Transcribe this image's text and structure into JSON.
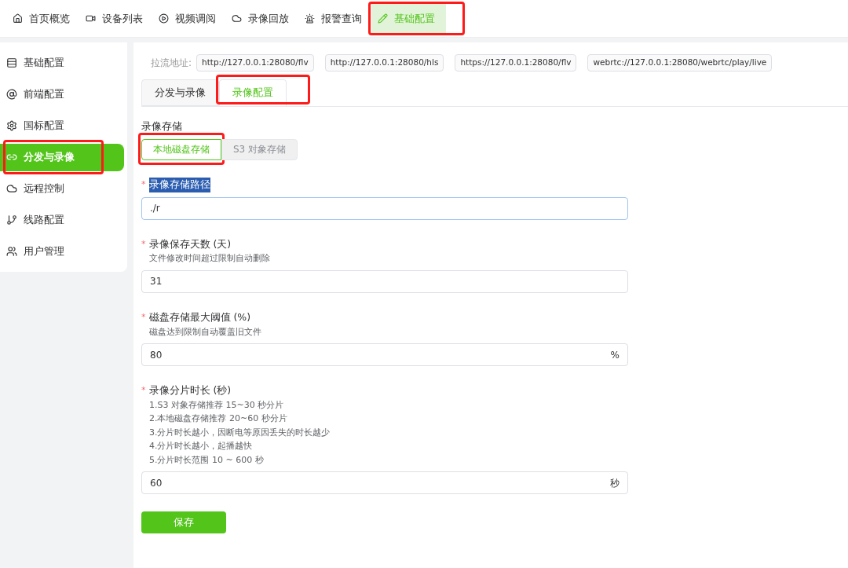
{
  "top_nav": [
    {
      "label": "首页概览",
      "selected": false,
      "highlighted": false
    },
    {
      "label": "设备列表",
      "selected": false,
      "highlighted": false
    },
    {
      "label": "视频调阅",
      "selected": false,
      "highlighted": false
    },
    {
      "label": "录像回放",
      "selected": false,
      "highlighted": false
    },
    {
      "label": "报警查询",
      "selected": false,
      "highlighted": false
    },
    {
      "label": "基础配置",
      "selected": true,
      "highlighted": true
    }
  ],
  "sidebar": {
    "items": [
      {
        "label": "基础配置",
        "selected": false,
        "highlighted": false
      },
      {
        "label": "前端配置",
        "selected": false,
        "highlighted": false
      },
      {
        "label": "国标配置",
        "selected": false,
        "highlighted": false
      },
      {
        "label": "分发与录像",
        "selected": true,
        "highlighted": true
      },
      {
        "label": "远程控制",
        "selected": false,
        "highlighted": false
      },
      {
        "label": "线路配置",
        "selected": false,
        "highlighted": false
      },
      {
        "label": "用户管理",
        "selected": false,
        "highlighted": false
      }
    ]
  },
  "stream_urls": {
    "label": "拉流地址:",
    "urls": [
      "http://127.0.0.1:28080/flv",
      "http://127.0.0.1:28080/hls",
      "https://127.0.0.1:28080/flv",
      "webrtc://127.0.0.1:28080/webrtc/play/live"
    ]
  },
  "tabs": [
    {
      "label": "分发与录像",
      "selected": false,
      "highlighted": false
    },
    {
      "label": "录像配置",
      "selected": true,
      "highlighted": true
    }
  ],
  "storage": {
    "label": "录像存储",
    "options": [
      {
        "label": "本地磁盘存储",
        "selected": true,
        "highlighted": true
      },
      {
        "label": "S3 对象存储",
        "selected": false,
        "highlighted": false
      }
    ]
  },
  "fields": [
    {
      "required_mark": "*",
      "label": "录像存储路径",
      "label_selected": true,
      "value": "./r",
      "focused": true
    },
    {
      "required_mark": "*",
      "label": "录像保存天数 (天)",
      "label_selected": false,
      "hints": [
        "文件修改时间超过限制自动删除"
      ],
      "value": "31",
      "focused": false
    },
    {
      "required_mark": "*",
      "label": "磁盘存储最大阈值 (%)",
      "label_selected": false,
      "hints": [
        "磁盘达到限制自动覆盖旧文件"
      ],
      "value": "80",
      "suffix": "%",
      "focused": false
    },
    {
      "required_mark": "*",
      "label": "录像分片时长 (秒)",
      "label_selected": false,
      "hints": [
        "1.S3 对象存储推荐 15~30 秒分片",
        "2.本地磁盘存储推荐 20~60 秒分片",
        "3.分片时长越小，因断电等原因丢失的时长越少",
        "4.分片时长越小，起播越快",
        "5.分片时长范围 10 ~ 600 秒"
      ],
      "value": "60",
      "suffix": "秒",
      "focused": false
    }
  ],
  "save_button": "保存"
}
